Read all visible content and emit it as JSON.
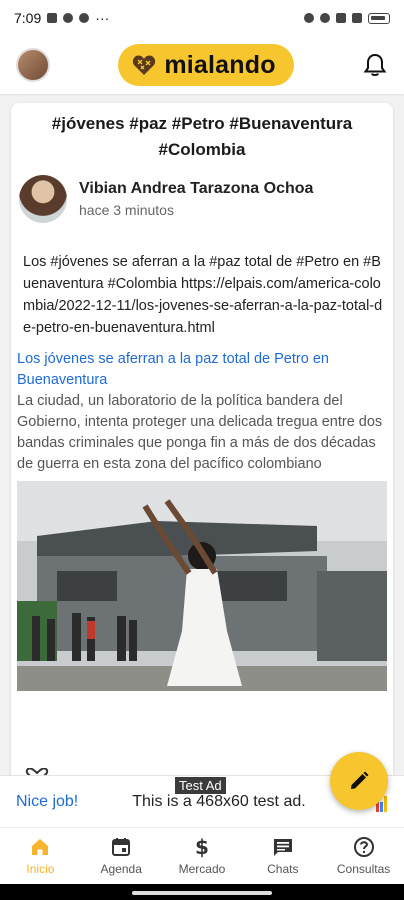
{
  "status": {
    "time": "7:09",
    "more": "···"
  },
  "header": {
    "brand": "mialando"
  },
  "post": {
    "title": "#jóvenes #paz #Petro #Buenaventura #Colombia",
    "author": "Vibian Andrea Tarazona Ochoa",
    "time": "hace 3 minutos",
    "text": "Los #jóvenes se aferran a la #paz total de #Petro en #Buenaventura #Colombia https://elpais.com/america-colombia/2022-12-11/los-jovenes-se-aferran-a-la-paz-total-de-petro-en-buenaventura.html",
    "link_title": "Los jóvenes se aferran a la paz total de Petro en Buenaventura",
    "link_desc": "La ciudad, un laboratorio de la política bandera del Gobierno, intenta proteger una delicada tregua entre dos bandas criminales que ponga fin a más de dos décadas de guerra en esta zona del pacífico colombiano"
  },
  "ad": {
    "label": "Test Ad",
    "nice": "Nice job!",
    "text": "This is a 468x60 test ad."
  },
  "nav": [
    {
      "label": "Inicio",
      "icon": "home-icon",
      "active": true
    },
    {
      "label": "Agenda",
      "icon": "calendar-icon",
      "active": false
    },
    {
      "label": "Mercado",
      "icon": "dollar-icon",
      "active": false
    },
    {
      "label": "Chats",
      "icon": "chat-icon",
      "active": false
    },
    {
      "label": "Consultas",
      "icon": "help-icon",
      "active": false
    }
  ],
  "colors": {
    "accent": "#f7c62f",
    "link": "#1e6bd6",
    "active_nav": "#f7b52f"
  }
}
